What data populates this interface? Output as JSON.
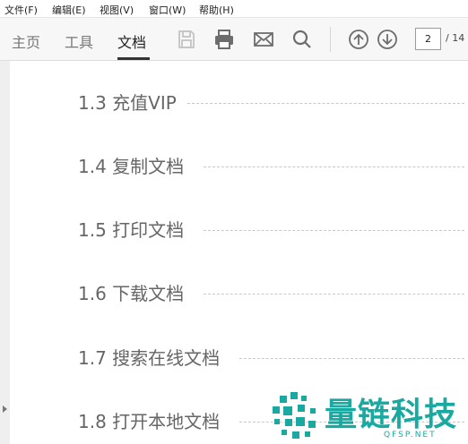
{
  "menu": {
    "items": [
      {
        "label": "文件(F)"
      },
      {
        "label": "编辑(E)"
      },
      {
        "label": "视图(V)"
      },
      {
        "label": "窗口(W)"
      },
      {
        "label": "帮助(H)"
      }
    ]
  },
  "toolbar": {
    "tabs": [
      {
        "label": "主页",
        "active": false
      },
      {
        "label": "工具",
        "active": false
      },
      {
        "label": "文档",
        "active": true
      }
    ],
    "icons": [
      "save-icon",
      "print-icon",
      "email-icon",
      "search-icon",
      "page-up-icon",
      "page-down-icon"
    ],
    "page_current": "2",
    "page_total": "/ 14"
  },
  "document": {
    "toc": [
      {
        "text": "1.3 充值VIP"
      },
      {
        "text": "1.4 复制文档"
      },
      {
        "text": "1.5 打印文档"
      },
      {
        "text": "1.6 下载文档"
      },
      {
        "text": "1.7 搜索在线文档"
      },
      {
        "text": "1.8 打开本地文档"
      }
    ]
  },
  "watermark": {
    "title": "量链科技",
    "subtitle": "QFSP.NET"
  },
  "colors": {
    "toolbar_bg": "#f7f7f7",
    "icon": "#6d6d6d",
    "icon_disabled": "#c4c4c4",
    "watermark": "#1aa9a0",
    "toc_text": "#666666"
  }
}
